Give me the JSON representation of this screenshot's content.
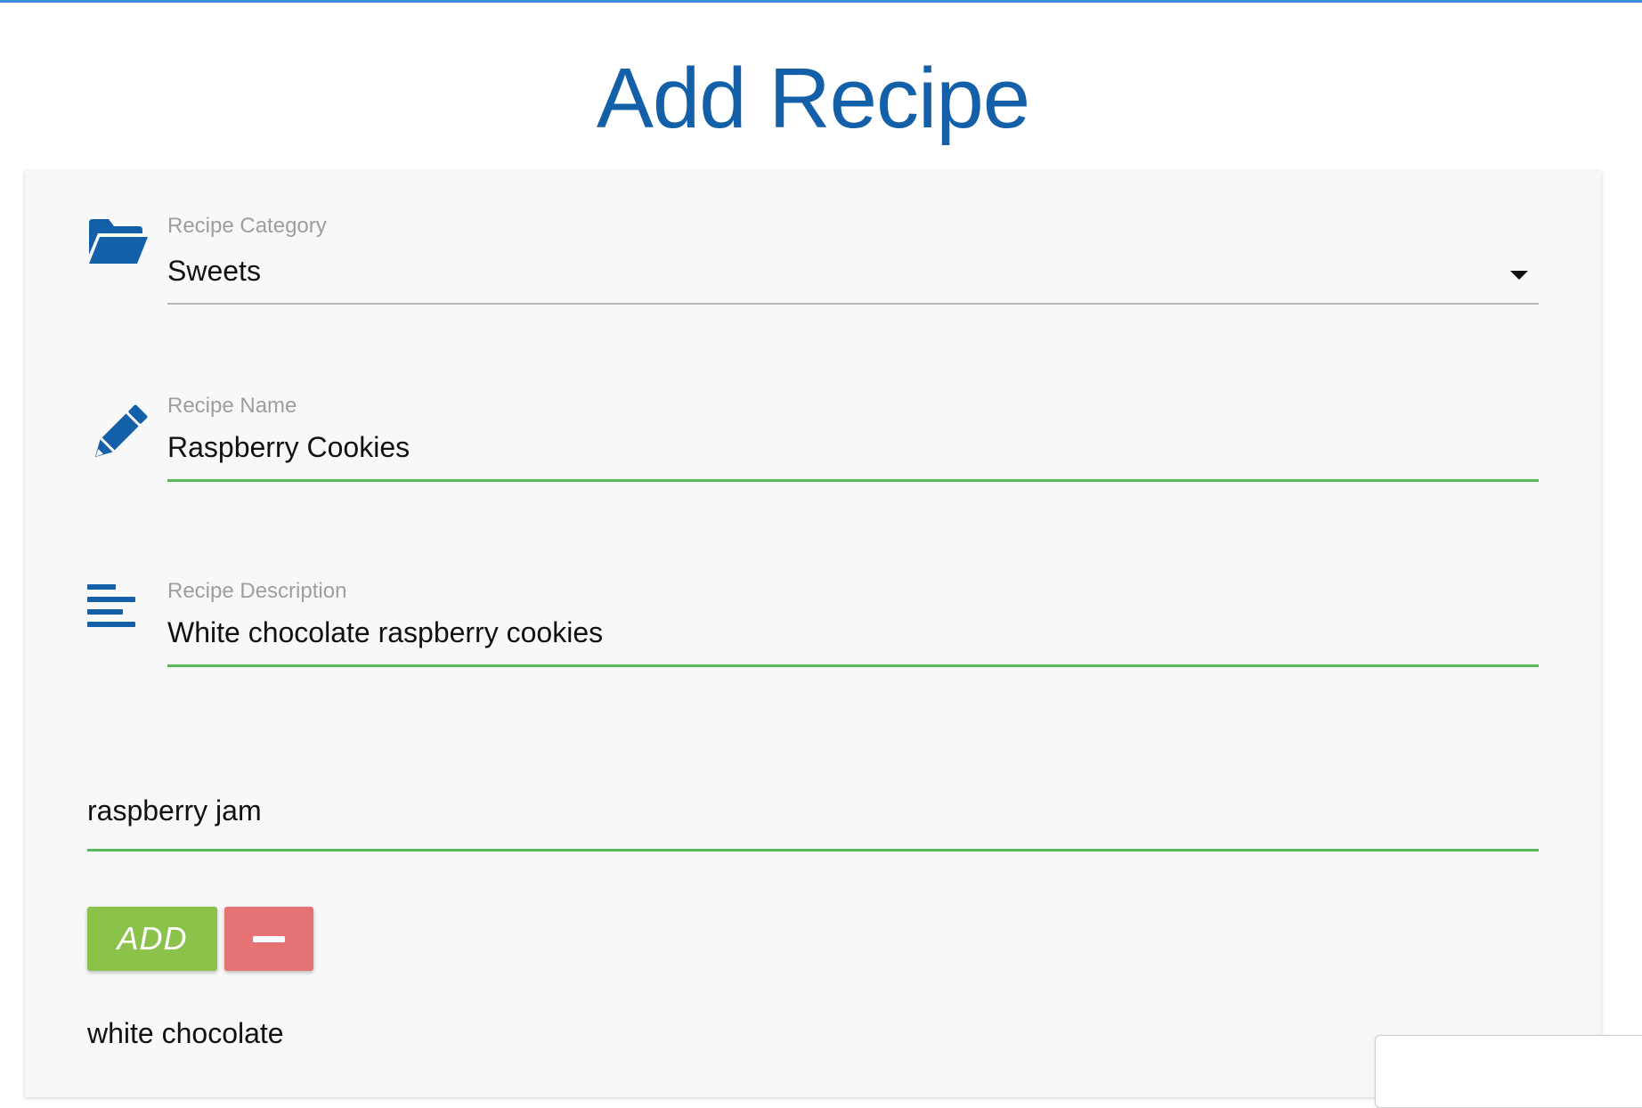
{
  "page": {
    "title": "Add Recipe",
    "accent_color": "#1460a8",
    "valid_color": "#5cb85c"
  },
  "form": {
    "category": {
      "label": "Recipe Category",
      "selected": "Sweets",
      "icon": "folder-open-icon"
    },
    "name": {
      "label": "Recipe Name",
      "value": "Raspberry Cookies",
      "icon": "pencil-icon"
    },
    "description": {
      "label": "Recipe Description",
      "value": "White chocolate raspberry cookies",
      "icon": "align-left-icon"
    },
    "ingredient_input": {
      "value": "raspberry jam"
    },
    "buttons": {
      "add_label": "ADD",
      "add_color": "#8bc34a",
      "remove_icon": "minus-icon",
      "remove_color": "#e57373"
    },
    "ingredients": [
      "white chocolate"
    ]
  }
}
